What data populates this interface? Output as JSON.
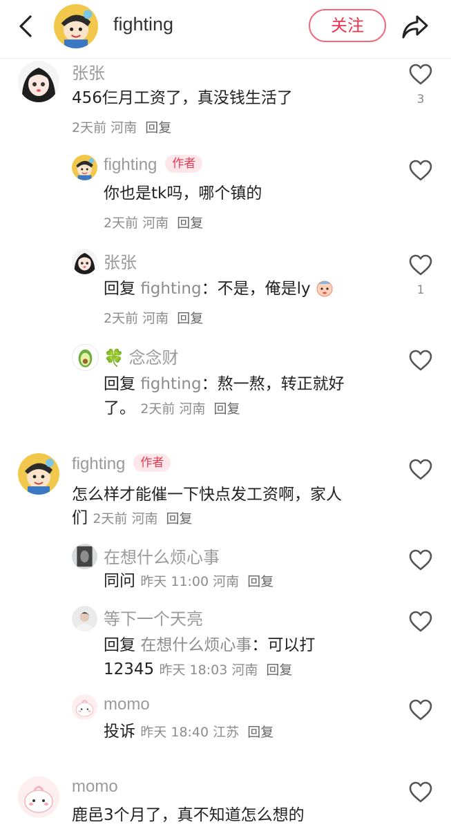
{
  "header": {
    "username": "fighting",
    "follow_label": "关注"
  },
  "labels": {
    "author_badge": "作者",
    "reply_prefix": "回复",
    "colon": "："
  },
  "comments": {
    "c1": {
      "user": "张张",
      "text": "456仨月工资了，真没钱生活了",
      "time": "2天前",
      "location": "河南",
      "reply": "回复",
      "likes": "3"
    },
    "r1": {
      "user": "fighting",
      "text": "你也是tk吗，哪个镇的",
      "time": "2天前",
      "location": "河南",
      "reply": "回复"
    },
    "r2": {
      "user": "张张",
      "reply_to": "fighting",
      "text": "不是，俺是ly",
      "time": "2天前",
      "location": "河南",
      "reply": "回复",
      "likes": "1"
    },
    "r3": {
      "user_icon": "🍀",
      "user": "念念财",
      "reply_to": "fighting",
      "text_line1": "熬一熬，转正就好",
      "text_line2": "了。",
      "time": "2天前",
      "location": "河南",
      "reply": "回复"
    },
    "c2": {
      "user": "fighting",
      "text_line1": "怎么样才能催一下快点发工资啊，家人",
      "text_line2": "们",
      "time": "2天前",
      "location": "河南",
      "reply": "回复"
    },
    "r4": {
      "user": "在想什么烦心事",
      "text": "同问",
      "time": "昨天 11:00",
      "location": "河南",
      "reply": "回复"
    },
    "r5": {
      "user": "等下一个天亮",
      "reply_to": "在想什么烦心事",
      "text_line1": "可以打",
      "text_line2": "12345",
      "time": "昨天 18:03",
      "location": "河南",
      "reply": "回复"
    },
    "r6": {
      "user": "momo",
      "text": "投诉",
      "time": "昨天 18:40",
      "location": "江苏",
      "reply": "回复"
    },
    "c3": {
      "user": "momo",
      "text": "鹿邑3个月了，真不知道怎么想的"
    }
  },
  "colors": {
    "accent": "#e8344e",
    "follow_border": "#f06a7c",
    "meta": "#8c8c8c"
  }
}
